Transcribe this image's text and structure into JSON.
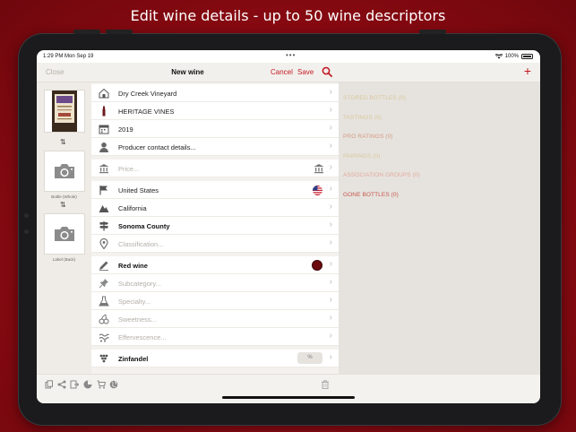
{
  "headline": "Edit wine details - up to 50 wine descriptors",
  "status": {
    "time": "1:29 PM  Mon Sep 19",
    "dots": "•••",
    "battery": "100%"
  },
  "nav": {
    "close": "Close",
    "title": "New wine",
    "cancel": "Cancel",
    "save": "Save"
  },
  "photos": {
    "front_label": "Bottle (Whole)",
    "back_label": "Label (Back)"
  },
  "form_rows": [
    {
      "text": "Dry Creek Vineyard",
      "style": "bold",
      "icon": "winery-icon"
    },
    {
      "text": "HERITAGE VINES",
      "style": "normal",
      "icon": "bottle-icon"
    },
    {
      "text": "2019",
      "style": "bold",
      "icon": "calendar-icon"
    },
    {
      "text": "Producer contact details...",
      "style": "placeholder",
      "icon": "person-icon"
    },
    {
      "text": "Price...",
      "style": "placeholder",
      "icon": "bank-icon"
    },
    {
      "text": "United States",
      "style": "normal",
      "icon": "flag-icon"
    },
    {
      "text": "California",
      "style": "normal",
      "icon": "mountain-icon"
    },
    {
      "text": "Sonoma County",
      "style": "bold",
      "icon": "signpost-icon"
    },
    {
      "text": "Classification...",
      "style": "placeholder",
      "icon": "pin-icon"
    },
    {
      "text": "Red wine",
      "style": "bold",
      "icon": "pen-icon"
    },
    {
      "text": "Subcategory...",
      "style": "placeholder",
      "icon": "pushpin-icon"
    },
    {
      "text": "Specialty...",
      "style": "placeholder",
      "icon": "flask-icon"
    },
    {
      "text": "Sweetness...",
      "style": "placeholder",
      "icon": "cherries-icon"
    },
    {
      "text": "Effervescence...",
      "style": "placeholder",
      "icon": "bubbles-icon"
    },
    {
      "text": "Zinfandel",
      "style": "bold",
      "icon": "grapes-icon"
    }
  ],
  "grape_percent": "%",
  "right_links": [
    {
      "text": "STORED BOTTLES (0)",
      "color": "#d8c79a"
    },
    {
      "text": "TASTINGS (0)",
      "color": "#d8c79a"
    },
    {
      "text": "PRO RATINGS (0)",
      "color": "#d39a7e"
    },
    {
      "text": "PAIRINGS (0)",
      "color": "#d8c79a"
    },
    {
      "text": "ASSOCIATION GROUPS (0)",
      "color": "#e2a898"
    },
    {
      "text": "GONE BOTTLES (0)",
      "color": "#c7564a"
    }
  ],
  "colors": {
    "accent": "#c21b24",
    "red_wine": "#6b0a0f"
  }
}
